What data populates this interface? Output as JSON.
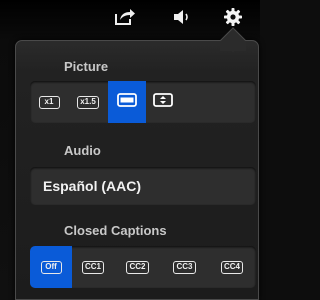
{
  "toolbar": {
    "icons": [
      "share-icon",
      "volume-icon",
      "gear-icon"
    ]
  },
  "popover": {
    "picture": {
      "title": "Picture",
      "options": [
        {
          "label": "x1",
          "icon": "zoom-1x-icon"
        },
        {
          "label": "x1.5",
          "icon": "zoom-1-5x-icon"
        },
        {
          "label": "",
          "icon": "widescreen-icon"
        },
        {
          "label": "",
          "icon": "fit-screen-icon"
        }
      ],
      "selected_index": 2
    },
    "audio": {
      "title": "Audio",
      "selected": "Español (AAC)"
    },
    "captions": {
      "title": "Closed Captions",
      "options": [
        "Off",
        "CC1",
        "CC2",
        "CC3",
        "CC4"
      ],
      "selected_index": 0
    }
  },
  "colors": {
    "accent": "#0a5bd8",
    "panel": "#1c1c1c",
    "control_bg": "#2e2e2e",
    "label": "#c8c8c8"
  }
}
